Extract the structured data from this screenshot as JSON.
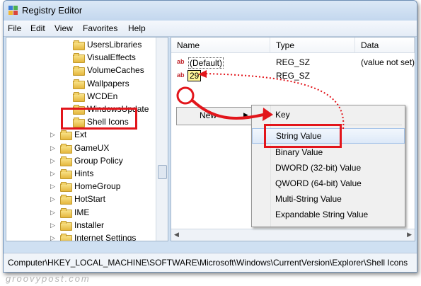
{
  "window": {
    "title": "Registry Editor"
  },
  "menu": [
    "File",
    "Edit",
    "View",
    "Favorites",
    "Help"
  ],
  "tree": [
    {
      "label": "UsersLibraries",
      "indent": 2
    },
    {
      "label": "VisualEffects",
      "indent": 2
    },
    {
      "label": "VolumeCaches",
      "indent": 2
    },
    {
      "label": "Wallpapers",
      "indent": 2
    },
    {
      "label": "WCDEn",
      "indent": 2
    },
    {
      "label": "WindowsUpdate",
      "indent": 2
    },
    {
      "label": "Shell Icons",
      "indent": 2,
      "selected": true
    },
    {
      "label": "Ext",
      "indent": 1
    },
    {
      "label": "GameUX",
      "indent": 1
    },
    {
      "label": "Group Policy",
      "indent": 1
    },
    {
      "label": "Hints",
      "indent": 1
    },
    {
      "label": "HomeGroup",
      "indent": 1
    },
    {
      "label": "HotStart",
      "indent": 1
    },
    {
      "label": "IME",
      "indent": 1
    },
    {
      "label": "Installer",
      "indent": 1
    },
    {
      "label": "Internet Settings",
      "indent": 1
    }
  ],
  "list": {
    "columns": [
      "Name",
      "Type",
      "Data"
    ],
    "rows": [
      {
        "name": "(Default)",
        "type": "REG_SZ",
        "data": "(value not set)"
      },
      {
        "name": "29",
        "type": "REG_SZ",
        "data": ""
      }
    ]
  },
  "context_menu": {
    "new_label": "New",
    "submenu": [
      "Key",
      "String Value",
      "Binary Value",
      "DWORD (32-bit) Value",
      "QWORD (64-bit) Value",
      "Multi-String Value",
      "Expandable String Value"
    ]
  },
  "status": "Computer\\HKEY_LOCAL_MACHINE\\SOFTWARE\\Microsoft\\Windows\\CurrentVersion\\Explorer\\Shell Icons",
  "watermark": "groovypost.com",
  "colors": {
    "annotation": "#e2151b",
    "selection": "#fff799"
  }
}
